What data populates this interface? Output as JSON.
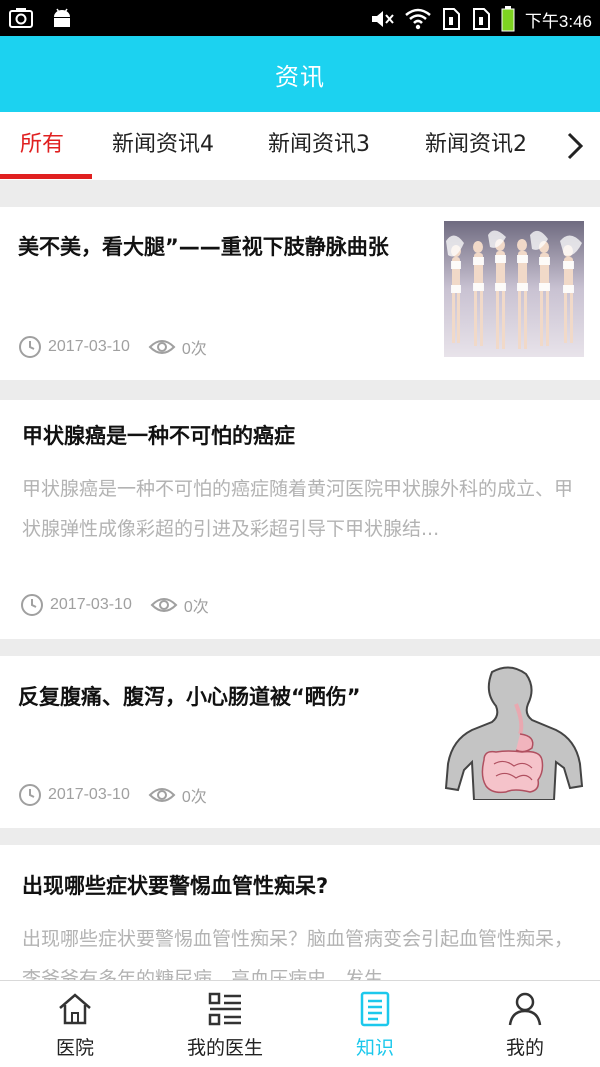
{
  "status_bar": {
    "time": "下午3:46",
    "left_icons": [
      "camera-icon",
      "android-icon"
    ],
    "right_icons": [
      "mute-icon",
      "wifi-icon",
      "sim1-icon",
      "sim2-icon",
      "battery-icon"
    ]
  },
  "header": {
    "title": "资讯"
  },
  "tabs": [
    {
      "label": "所有",
      "active": true
    },
    {
      "label": "新闻资讯4",
      "active": false
    },
    {
      "label": "新闻资讯3",
      "active": false
    },
    {
      "label": "新闻资讯2",
      "active": false
    }
  ],
  "articles": [
    {
      "title": "美不美，看大腿”——重视下肢静脉曲张",
      "date": "2017-03-10",
      "views": "0次",
      "thumbnail": "runway-models-image"
    },
    {
      "title": "甲状腺癌是一种不可怕的癌症",
      "summary": "甲状腺癌是一种不可怕的癌症随着黄河医院甲状腺外科的成立、甲状腺弹性成像彩超的引进及彩超引导下甲状腺结...",
      "date": "2017-03-10",
      "views": "0次"
    },
    {
      "title": "反复腹痛、腹泻，小心肠道被“晒伤”",
      "date": "2017-03-10",
      "views": "0次",
      "thumbnail": "intestine-illustration"
    },
    {
      "title": "出现哪些症状要警惕血管性痴呆?",
      "summary": "出现哪些症状要警惕血管性痴呆？脑血管病变会引起血管性痴呆，李爷爷有多年的糖尿病、高血压病史，发生"
    }
  ],
  "bottom_nav": [
    {
      "label": "医院",
      "icon": "home-icon",
      "active": false
    },
    {
      "label": "我的医生",
      "icon": "list-icon",
      "active": false
    },
    {
      "label": "知识",
      "icon": "document-icon",
      "active": true
    },
    {
      "label": "我的",
      "icon": "user-icon",
      "active": false
    }
  ],
  "colors": {
    "accent": "#1cd2f0",
    "tab_active": "#e02020",
    "nav_active": "#1cc8ec",
    "muted_text": "#a0a0a0"
  }
}
